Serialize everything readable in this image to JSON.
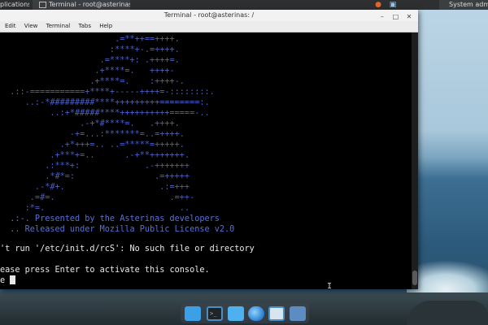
{
  "top_panel": {
    "apps_label": "plications",
    "task_label": "Terminal - root@asterinas",
    "system_label": "System admin"
  },
  "window": {
    "title": "Terminal - root@asterinas: /",
    "menu": [
      "Edit",
      "View",
      "Terminal",
      "Tabs",
      "Help"
    ],
    "controls": {
      "minimize": "–",
      "maximize": "□",
      "close": "✕"
    }
  },
  "terminal": {
    "ascii_art": [
      "                       .=**++==++++.",
      "                      :****+-.=++++.",
      "                    .=****+: .++++=.",
      "                   .+****=.   ++++-",
      "                  .+****=.    :++++-.",
      "  .::-===========+****+-----++++=-::::::::.",
      "     ..:-*#########****+++++++++========:.",
      "          ..:+*#####****++++++++++=====-..",
      "                .-+*#****=.   .++++.",
      "              -+=...:*******=..=++++.",
      "            .+*+++=.. ..=*****=+++++.",
      "          .+***+=..      .-+**+++++++.",
      "         .:***+:             .-+++++++",
      "         .*#*=:                .=+++++",
      "       .-*#+.                   .:=+++",
      "      .=#=.                       .=++-",
      "     :*=.                           ..",
      "  .:-. Presented by the Asterinas developers",
      "  .. Released under Mozilla Public License v2.0"
    ],
    "error_line": "'t run '/etc/init.d/rcS': No such file or directory",
    "prompt_line": "ease press Enter to activate this console.",
    "input_line": "e "
  },
  "dock": {
    "items": [
      "files-icon",
      "terminal-icon",
      "documents-icon",
      "browser-icon",
      "search-icon",
      "folder-icon"
    ]
  },
  "colors": {
    "terminal_bg": "#000000",
    "ascii_blue": "#4a5fc4",
    "text": "#e8e8e8",
    "titlebar": "#f2f2f2",
    "panel": "#2d2f31"
  }
}
